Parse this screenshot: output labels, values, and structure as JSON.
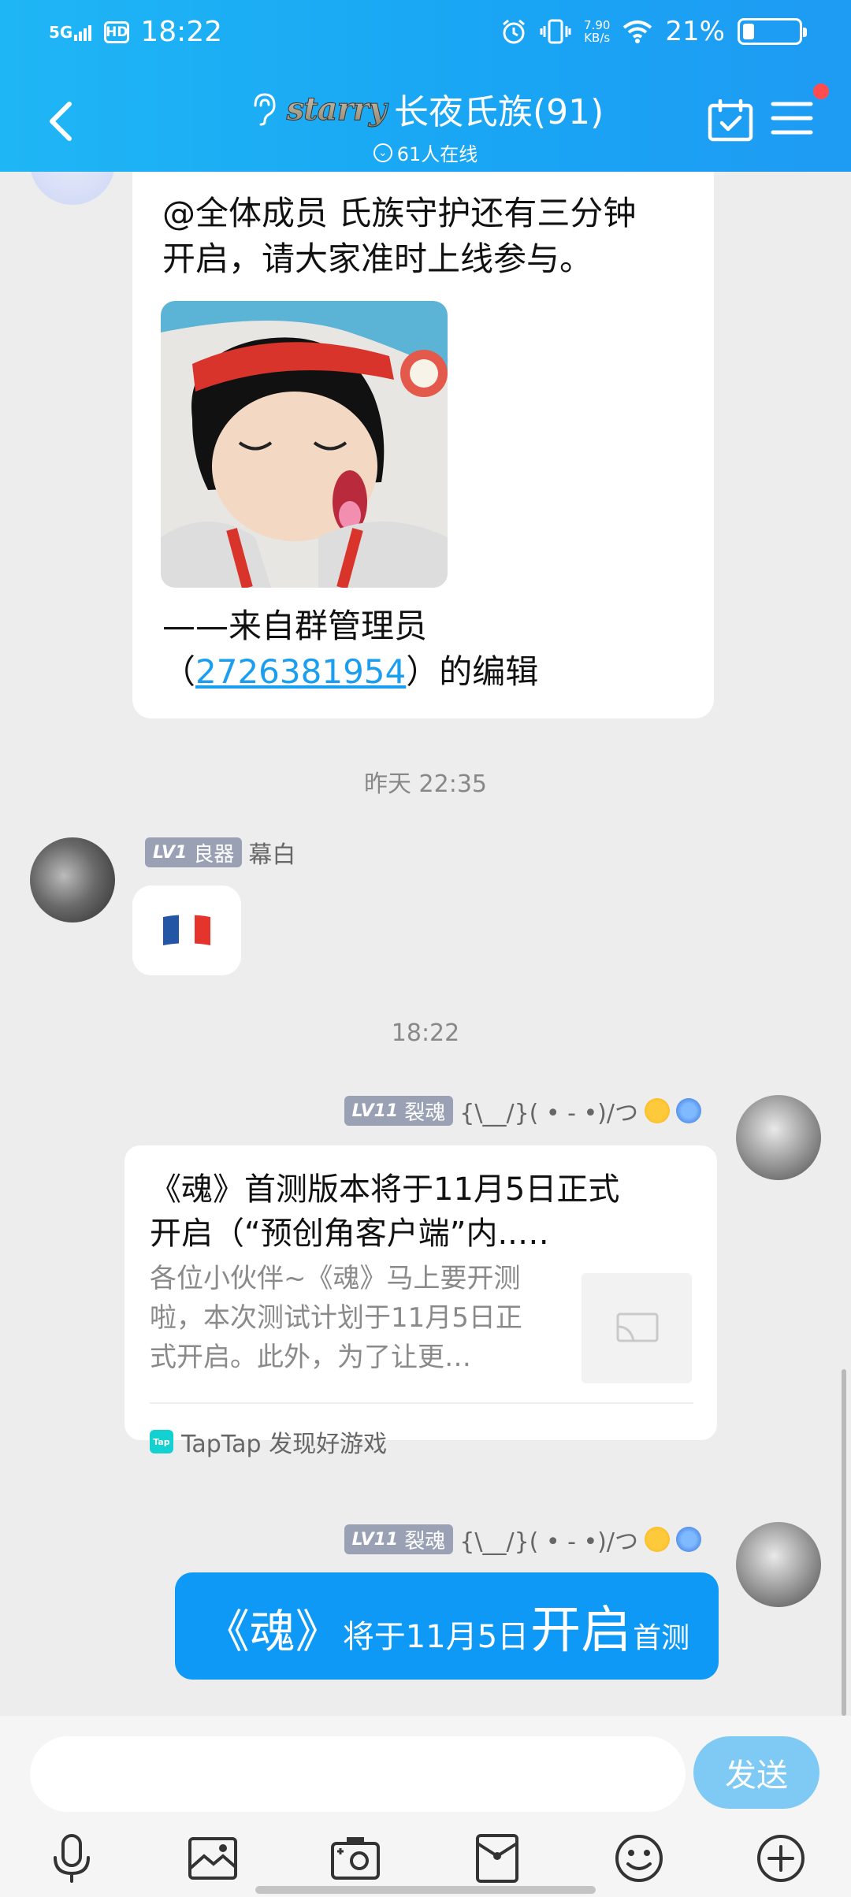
{
  "status_bar": {
    "network": "5G",
    "hd_label": "HD",
    "time": "18:22",
    "speed_value": "7.90",
    "speed_unit": "KB/s",
    "battery": "21%",
    "battery_level": 0.21
  },
  "header": {
    "logo_text": "starry",
    "title": "长夜氏族(91)",
    "online": "61人在线"
  },
  "messages": {
    "announcement": {
      "line1": "@全体成员 氏族守护还有三分钟",
      "line2": "开启，请大家准时上线参与。",
      "footer_line1": "——来自群管理员",
      "footer_open": "（",
      "footer_link": "2726381954",
      "footer_close": "）的编辑"
    },
    "timestamp1": "昨天 22:35",
    "msg_flag": {
      "level": "LV1",
      "title": "良器",
      "nickname": "幕白"
    },
    "timestamp2": "18:22",
    "msg_card": {
      "level": "LV11",
      "title": "裂魂",
      "nickname": "{\\__/}( • - •)/つ",
      "card_title_line1": "《魂》首测版本将于11月5日正式",
      "card_title_line2": "开启（“预创角客户端”内..…",
      "card_desc_line1": "各位小伙伴~《魂》马上要开测",
      "card_desc_line2": "啦，本次测试计划于11月5日正",
      "card_desc_line3": "式开启。此外，为了让更…",
      "source": "TapTap 发现好游戏",
      "source_icon": "Tap"
    },
    "msg_text": {
      "level": "LV11",
      "title": "裂魂",
      "nickname": "{\\__/}( • - •)/つ",
      "part1": "《魂》",
      "part2": "将于11月5日",
      "part3": "开启",
      "part4": "首测"
    }
  },
  "input": {
    "placeholder": "",
    "send_label": "发送"
  },
  "toolbar": [
    "mic-icon",
    "photo-icon",
    "camera-icon",
    "red-packet-icon",
    "emoji-icon",
    "plus-icon"
  ],
  "colors": {
    "header_bg": "#19a6f4",
    "bubble_blue": "#0d99f5",
    "send_btn": "#7ecaf5",
    "badge": "#9aa1b4",
    "link": "#1a9ef0"
  }
}
